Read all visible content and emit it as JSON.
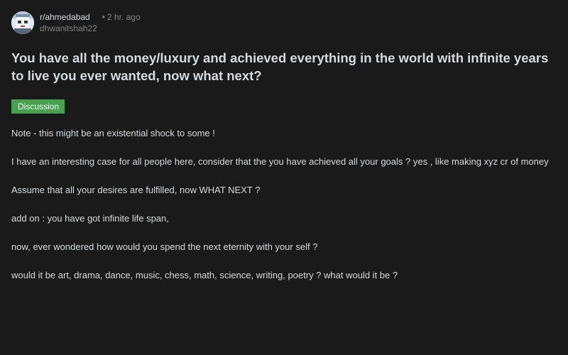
{
  "post": {
    "subreddit": "r/ahmedabad",
    "time_ago": "2 hr. ago",
    "author": "dhwanitshah22",
    "title": "You have all the money/luxury and achieved everything in the world with infinite years to live you ever wanted, now what next?",
    "flair": "Discussion",
    "paragraphs": [
      "Note - this might be an existential shock to some !",
      "I have an interesting case for all people here, consider that the you have achieved all your goals ? yes , like making xyz cr of money",
      "Assume that all your desires are fulfilled, now WHAT NEXT ?",
      "add on : you have got infinite life span,",
      "now, ever wondered how would you spend the next eternity with your self ?",
      "would it be art, drama, dance, music, chess, math, science, writing, poetry ? what would it be ?"
    ]
  },
  "icons": {
    "avatar": "subreddit-avatar-icon"
  },
  "colors": {
    "background": "#1a1a1b",
    "text": "#d7dadc",
    "muted": "#818384",
    "flair": "#46a24f"
  }
}
